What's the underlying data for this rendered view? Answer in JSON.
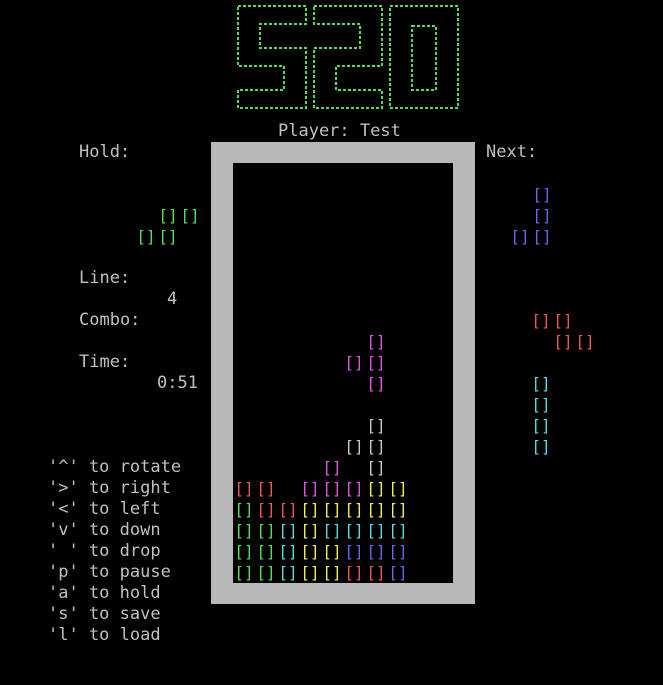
{
  "logo_text": "520",
  "player_label": "Player: Test",
  "hold": {
    "label": "Hold:",
    "cells": [
      [
        1,
        0,
        "green"
      ],
      [
        2,
        0,
        "green"
      ],
      [
        0,
        1,
        "green"
      ],
      [
        1,
        1,
        "green"
      ]
    ]
  },
  "line": {
    "label": "Line:",
    "value": "4"
  },
  "combo": {
    "label": "Combo:",
    "value": ""
  },
  "time": {
    "label": "Time:",
    "value": "0:51"
  },
  "next": {
    "label": "Next:",
    "pieces": [
      {
        "cells": [
          [
            1,
            0,
            "blue"
          ],
          [
            1,
            1,
            "blue"
          ],
          [
            0,
            2,
            "blue"
          ],
          [
            1,
            2,
            "blue"
          ]
        ]
      },
      {
        "cells": [
          [
            0,
            0,
            "red"
          ],
          [
            1,
            0,
            "red"
          ],
          [
            1,
            1,
            "red"
          ],
          [
            2,
            1,
            "red"
          ]
        ]
      },
      {
        "cells": [
          [
            0,
            0,
            "cyan"
          ],
          [
            0,
            1,
            "cyan"
          ],
          [
            0,
            2,
            "cyan"
          ],
          [
            0,
            3,
            "cyan"
          ]
        ]
      }
    ]
  },
  "controls": [
    "'^' to rotate",
    "'>' to right",
    "'<' to left",
    "'v' to down",
    "' ' to drop",
    "'p' to pause",
    "'a' to hold",
    "'s' to save",
    "'l' to load"
  ],
  "cell_glyph": "[]",
  "colors": {
    "green": "#55dd55",
    "blue": "#6666ee",
    "red": "#ee5555",
    "cyan": "#55dddd",
    "magenta": "#dd55dd",
    "yellow": "#eeee55",
    "white": "#c8c8c8",
    "logo": "#55dd55",
    "frame": "#b8b8b8"
  },
  "board": {
    "cols": 10,
    "rows": 20,
    "cells": [
      [
        6,
        8,
        "magenta"
      ],
      [
        5,
        9,
        "magenta"
      ],
      [
        6,
        9,
        "magenta"
      ],
      [
        6,
        10,
        "magenta"
      ],
      [
        6,
        12,
        "white"
      ],
      [
        5,
        13,
        "white"
      ],
      [
        6,
        13,
        "white"
      ],
      [
        4,
        14,
        "magenta"
      ],
      [
        6,
        14,
        "white"
      ],
      [
        0,
        15,
        "red"
      ],
      [
        1,
        15,
        "red"
      ],
      [
        3,
        15,
        "magenta"
      ],
      [
        4,
        15,
        "magenta"
      ],
      [
        5,
        15,
        "magenta"
      ],
      [
        6,
        15,
        "yellow"
      ],
      [
        7,
        15,
        "yellow"
      ],
      [
        0,
        16,
        "green"
      ],
      [
        1,
        16,
        "red"
      ],
      [
        2,
        16,
        "red"
      ],
      [
        3,
        16,
        "yellow"
      ],
      [
        4,
        16,
        "yellow"
      ],
      [
        5,
        16,
        "yellow"
      ],
      [
        6,
        16,
        "yellow"
      ],
      [
        7,
        16,
        "yellow"
      ],
      [
        0,
        17,
        "green"
      ],
      [
        1,
        17,
        "green"
      ],
      [
        2,
        17,
        "cyan"
      ],
      [
        3,
        17,
        "yellow"
      ],
      [
        4,
        17,
        "cyan"
      ],
      [
        5,
        17,
        "cyan"
      ],
      [
        6,
        17,
        "cyan"
      ],
      [
        7,
        17,
        "cyan"
      ],
      [
        0,
        18,
        "green"
      ],
      [
        1,
        18,
        "green"
      ],
      [
        2,
        18,
        "cyan"
      ],
      [
        3,
        18,
        "yellow"
      ],
      [
        4,
        18,
        "yellow"
      ],
      [
        5,
        18,
        "blue"
      ],
      [
        6,
        18,
        "blue"
      ],
      [
        7,
        18,
        "blue"
      ],
      [
        0,
        19,
        "green"
      ],
      [
        1,
        19,
        "green"
      ],
      [
        2,
        19,
        "cyan"
      ],
      [
        3,
        19,
        "yellow"
      ],
      [
        4,
        19,
        "yellow"
      ],
      [
        5,
        19,
        "red"
      ],
      [
        6,
        19,
        "red"
      ],
      [
        7,
        19,
        "blue"
      ]
    ]
  }
}
